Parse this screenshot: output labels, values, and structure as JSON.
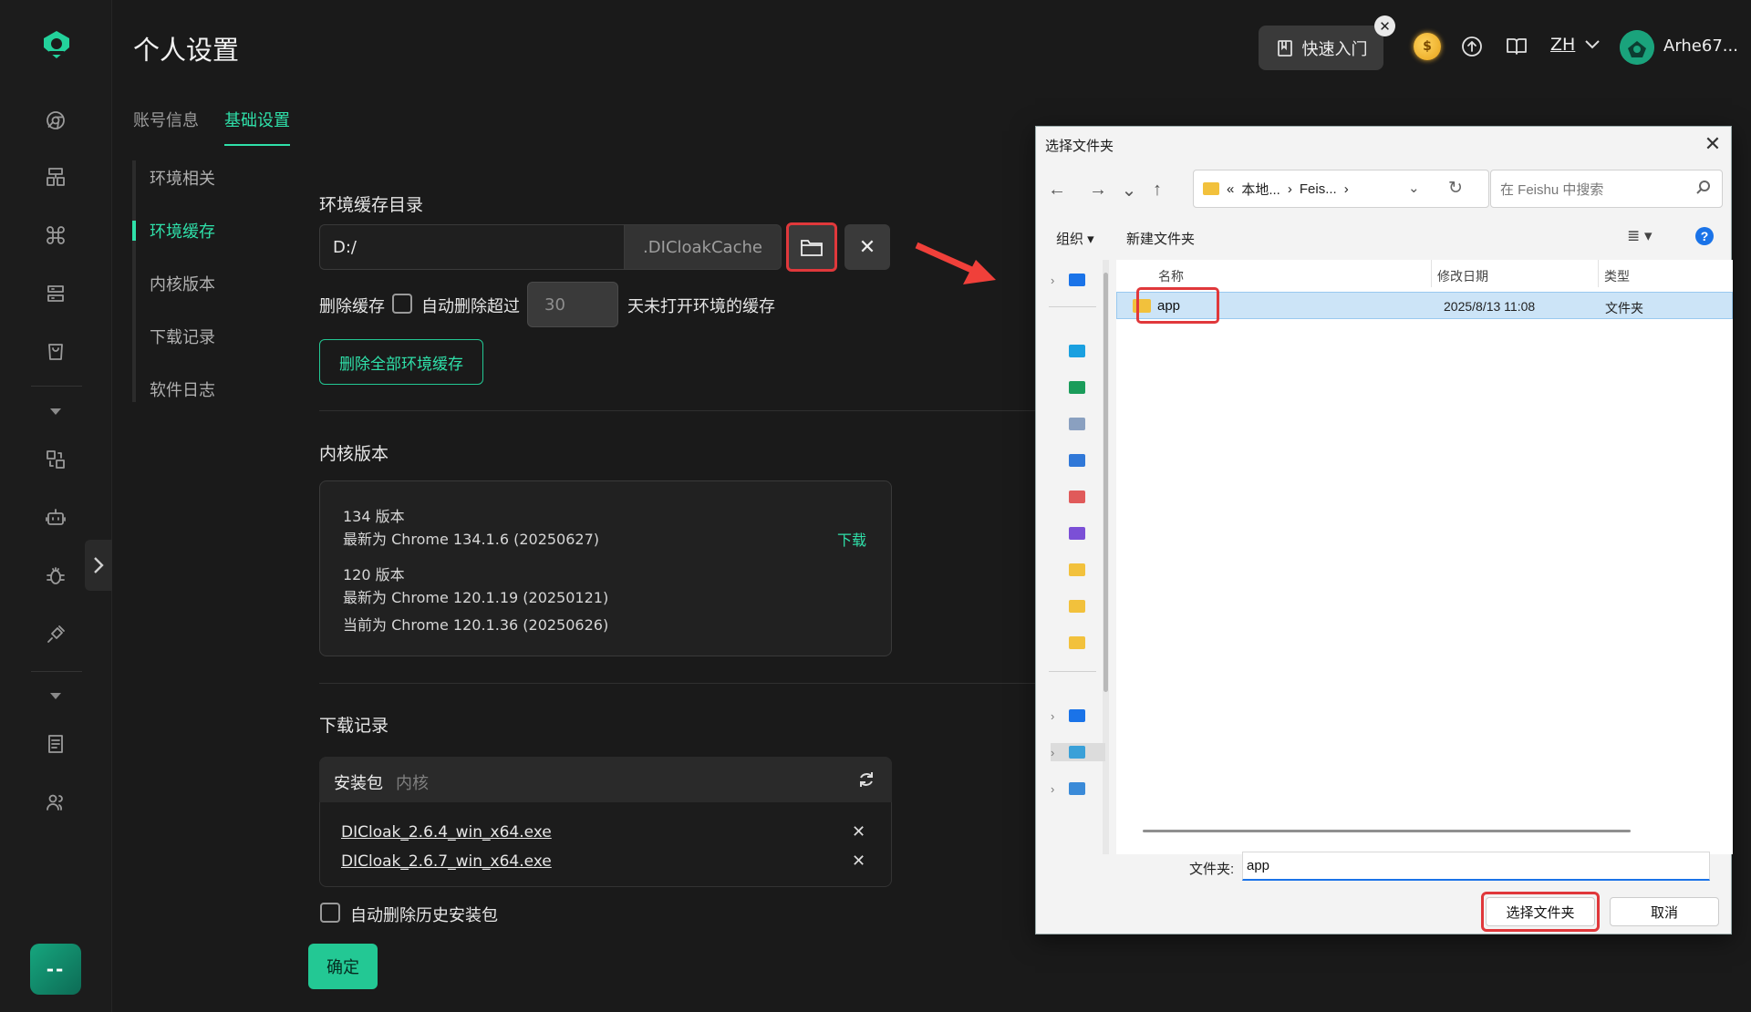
{
  "header": {
    "title": "个人设置",
    "tabs": [
      {
        "label": "账号信息"
      },
      {
        "label": "基础设置"
      }
    ],
    "quickstart_label": "快速入门",
    "quickstart_close": "✕",
    "coin_glyph": "$",
    "lang": "ZH",
    "username": "Arhe67..."
  },
  "subnav": {
    "items": [
      {
        "label": "环境相关"
      },
      {
        "label": "环境缓存"
      },
      {
        "label": "内核版本"
      },
      {
        "label": "下载记录"
      },
      {
        "label": "软件日志"
      }
    ],
    "active": "环境缓存"
  },
  "rail": {
    "icons": [
      "browser-icon",
      "layout-icon",
      "command-icon",
      "server-icon",
      "cart-icon",
      "transfer-icon",
      "robot-icon",
      "bug-icon",
      "plug-icon",
      "notes-icon",
      "team-icon"
    ],
    "user_chip": "--"
  },
  "cache": {
    "title": "环境缓存目录",
    "path_value": "D:/",
    "path_suffix": ".DICloakCache",
    "clear_glyph": "✕",
    "delete_label": "删除缓存",
    "auto_delete_label": "自动删除超过",
    "auto_delete_checked": false,
    "days_value": "30",
    "days_suffix": "天未打开环境的缓存",
    "delete_all_button": "删除全部环境缓存"
  },
  "kernel": {
    "title": "内核版本",
    "lines": [
      "134 版本",
      "最新为 Chrome 134.1.6 (20250627)",
      "120 版本",
      "最新为 Chrome 120.1.19 (20250121)",
      "当前为 Chrome 120.1.36 (20250626)"
    ],
    "download_label": "下载"
  },
  "downloads": {
    "title": "下载记录",
    "tabs": [
      {
        "label": "安装包"
      },
      {
        "label": "内核"
      }
    ],
    "files": [
      {
        "name": "DICloak_2.6.4_win_x64.exe"
      },
      {
        "name": "DICloak_2.6.7_win_x64.exe"
      }
    ],
    "remove_glyph": "✕",
    "auto_delete_label": "自动删除历史安装包",
    "auto_delete_checked": false
  },
  "confirm_label": "确定",
  "dialog": {
    "title": "选择文件夹",
    "close_glyph": "✕",
    "nav": {
      "back": "←",
      "forward": "→",
      "recent": "⌄",
      "up": "↑"
    },
    "address": [
      "«",
      "本地...",
      "›",
      "Feis...",
      "›"
    ],
    "address_dropdown": "⌄",
    "refresh_glyph": "↻",
    "search_placeholder": "在 Feishu 中搜索",
    "toolbar": {
      "organize": "组织 ▾",
      "new_folder": "新建文件夹",
      "view": "≣ ▾",
      "help": "?"
    },
    "columns": {
      "name": "名称",
      "modified": "修改日期",
      "type": "类型"
    },
    "rows": [
      {
        "name": "app",
        "modified": "2025/8/13 11:08",
        "type": "文件夹",
        "selected": true
      }
    ],
    "filename_label": "文件夹:",
    "filename_value": "app",
    "select_button": "选择文件夹",
    "cancel_button": "取消",
    "tree_colors": [
      "#1a73e8",
      "#1aa0e0",
      "#1a9c5a",
      "#8aa0c0",
      "#3078d8",
      "#e05a5a",
      "#7b4fd6",
      "#f2c13c",
      "#f2c13c",
      "#f2c13c",
      "#1a73e8",
      "#3aa0d8",
      "#3a8ad8"
    ]
  },
  "colors": {
    "accent": "#2fe0a9",
    "highlight": "#e0383b",
    "arrow": "#f0403a"
  }
}
